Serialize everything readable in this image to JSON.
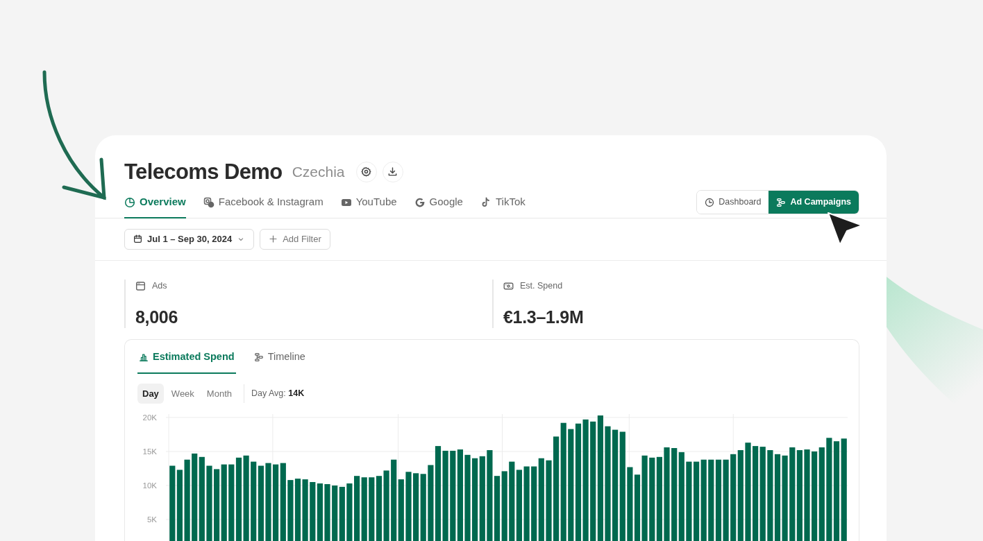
{
  "header": {
    "title": "Telecoms Demo",
    "subtitle": "Czechia"
  },
  "nav_tabs": [
    {
      "label": "Overview",
      "selected": true
    },
    {
      "label": "Facebook & Instagram",
      "selected": false
    },
    {
      "label": "YouTube",
      "selected": false
    },
    {
      "label": "Google",
      "selected": false
    },
    {
      "label": "TikTok",
      "selected": false
    }
  ],
  "view_switch": [
    {
      "label": "Dashboard",
      "selected": false
    },
    {
      "label": "Ad Campaigns",
      "selected": true
    }
  ],
  "filters": {
    "date_range": "Jul 1 – Sep 30, 2024",
    "add_filter": "Add Filter"
  },
  "stats": [
    {
      "label": "Ads",
      "value": "8,006"
    },
    {
      "label": "Est. Spend",
      "value": "€1.3–1.9M"
    }
  ],
  "chart_panel": {
    "tabs": [
      {
        "label": "Estimated Spend",
        "selected": true
      },
      {
        "label": "Timeline",
        "selected": false
      }
    ],
    "periods": [
      {
        "label": "Day",
        "selected": true
      },
      {
        "label": "Week",
        "selected": false
      },
      {
        "label": "Month",
        "selected": false
      }
    ],
    "summary": "Day Avg: **14K**",
    "chart_data": {
      "type": "bar",
      "grid": true,
      "ylim": [
        0,
        20500
      ],
      "yticks": [
        {
          "value": 5000,
          "label": "5K"
        },
        {
          "value": 10000,
          "label": "10K"
        },
        {
          "value": 15000,
          "label": "15K"
        },
        {
          "value": 20000,
          "label": "20K"
        }
      ],
      "series": [
        {
          "color": "#00694f",
          "values": [
            12900,
            12300,
            13800,
            14700,
            14200,
            12900,
            12400,
            13100,
            13100,
            14100,
            14400,
            13500,
            12900,
            13300,
            13100,
            13300,
            10800,
            11000,
            10900,
            10500,
            10300,
            10200,
            10000,
            9800,
            10300,
            11400,
            11200,
            11200,
            11400,
            12200,
            13800,
            10900,
            12000,
            11800,
            11700,
            13000,
            15800,
            15100,
            15100,
            15300,
            14500,
            14000,
            14300,
            15200,
            11400,
            12100,
            13500,
            12300,
            12800,
            12800,
            14000,
            13700,
            17200,
            19200,
            18300,
            19100,
            19700,
            19400,
            20300,
            18700,
            18200,
            17900,
            12700,
            11600,
            14400,
            14100,
            14200,
            15600,
            15500,
            14900,
            13500,
            13500,
            13800,
            13800,
            13800,
            13800,
            14600,
            15200,
            16300,
            15800,
            15700,
            15200,
            14600,
            14400,
            15600,
            15200,
            15300,
            15000,
            15600,
            17000,
            16500,
            16900
          ]
        }
      ]
    }
  }
}
